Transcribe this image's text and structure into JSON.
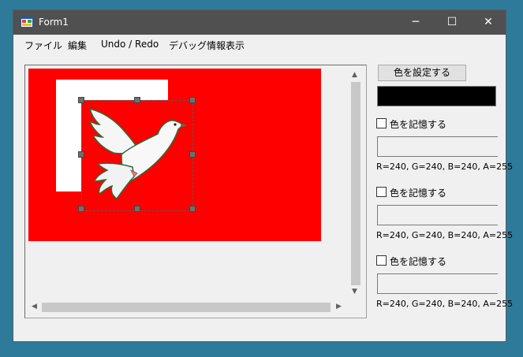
{
  "window": {
    "title": "Form1",
    "controls": {
      "minimize": "─",
      "maximize": "☐",
      "close": "✕"
    }
  },
  "menu": {
    "items": [
      "ファイル",
      "編集",
      "Undo / Redo",
      "デバッグ情報表示"
    ]
  },
  "toolbar": {
    "set_color_button": "色を設定する",
    "current_color": "#000000"
  },
  "memory_slots": [
    {
      "label": "色を記憶する",
      "checked": false,
      "rgba": "R=240, G=240, B=240, A=255"
    },
    {
      "label": "色を記憶する",
      "checked": false,
      "rgba": "R=240, G=240, B=240, A=255"
    },
    {
      "label": "色を記憶する",
      "checked": false,
      "rgba": "R=240, G=240, B=240, A=255"
    }
  ],
  "canvas": {
    "background_color": "#ff0000",
    "rect_color": "#ffffff",
    "image": "dove-image"
  },
  "scrollbars": {
    "up": "▲",
    "down": "▼",
    "left": "◀",
    "right": "▶"
  }
}
